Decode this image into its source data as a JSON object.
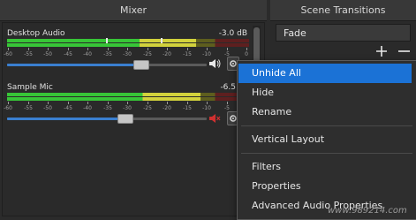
{
  "panels": {
    "mixer_title": "Mixer",
    "scene_title": "Scene Transitions"
  },
  "channels": [
    {
      "name": "Desktop Audio",
      "db": "-3.0 dB",
      "meter_level": 0.78,
      "volume": 0.67,
      "muted": false
    },
    {
      "name": "Sample Mic",
      "db": "-6.5",
      "meter_level": 0.8,
      "volume": 0.59,
      "muted": true
    }
  ],
  "meter_scale": [
    "-60",
    "-55",
    "-50",
    "-45",
    "-40",
    "-35",
    "-30",
    "-25",
    "-20",
    "-15",
    "-10",
    "-5",
    "0"
  ],
  "scene_transitions": {
    "selected": "Fade"
  },
  "context_menu": {
    "items": [
      "Unhide All",
      "Hide",
      "Rename",
      "Vertical Layout",
      "Filters",
      "Properties",
      "Advanced Audio Properties"
    ],
    "highlighted": "Unhide All"
  },
  "watermark": "www.989214.com",
  "colors": {
    "highlight": "#1b72d6",
    "meter_green": "#37c637",
    "meter_yellow": "#d2d23c",
    "mute_red": "#d03030",
    "slider_blue": "#3a7fd0"
  },
  "icons": [
    "speaker-icon",
    "muted-speaker-icon",
    "gear-icon",
    "plus-icon",
    "minus-icon"
  ]
}
